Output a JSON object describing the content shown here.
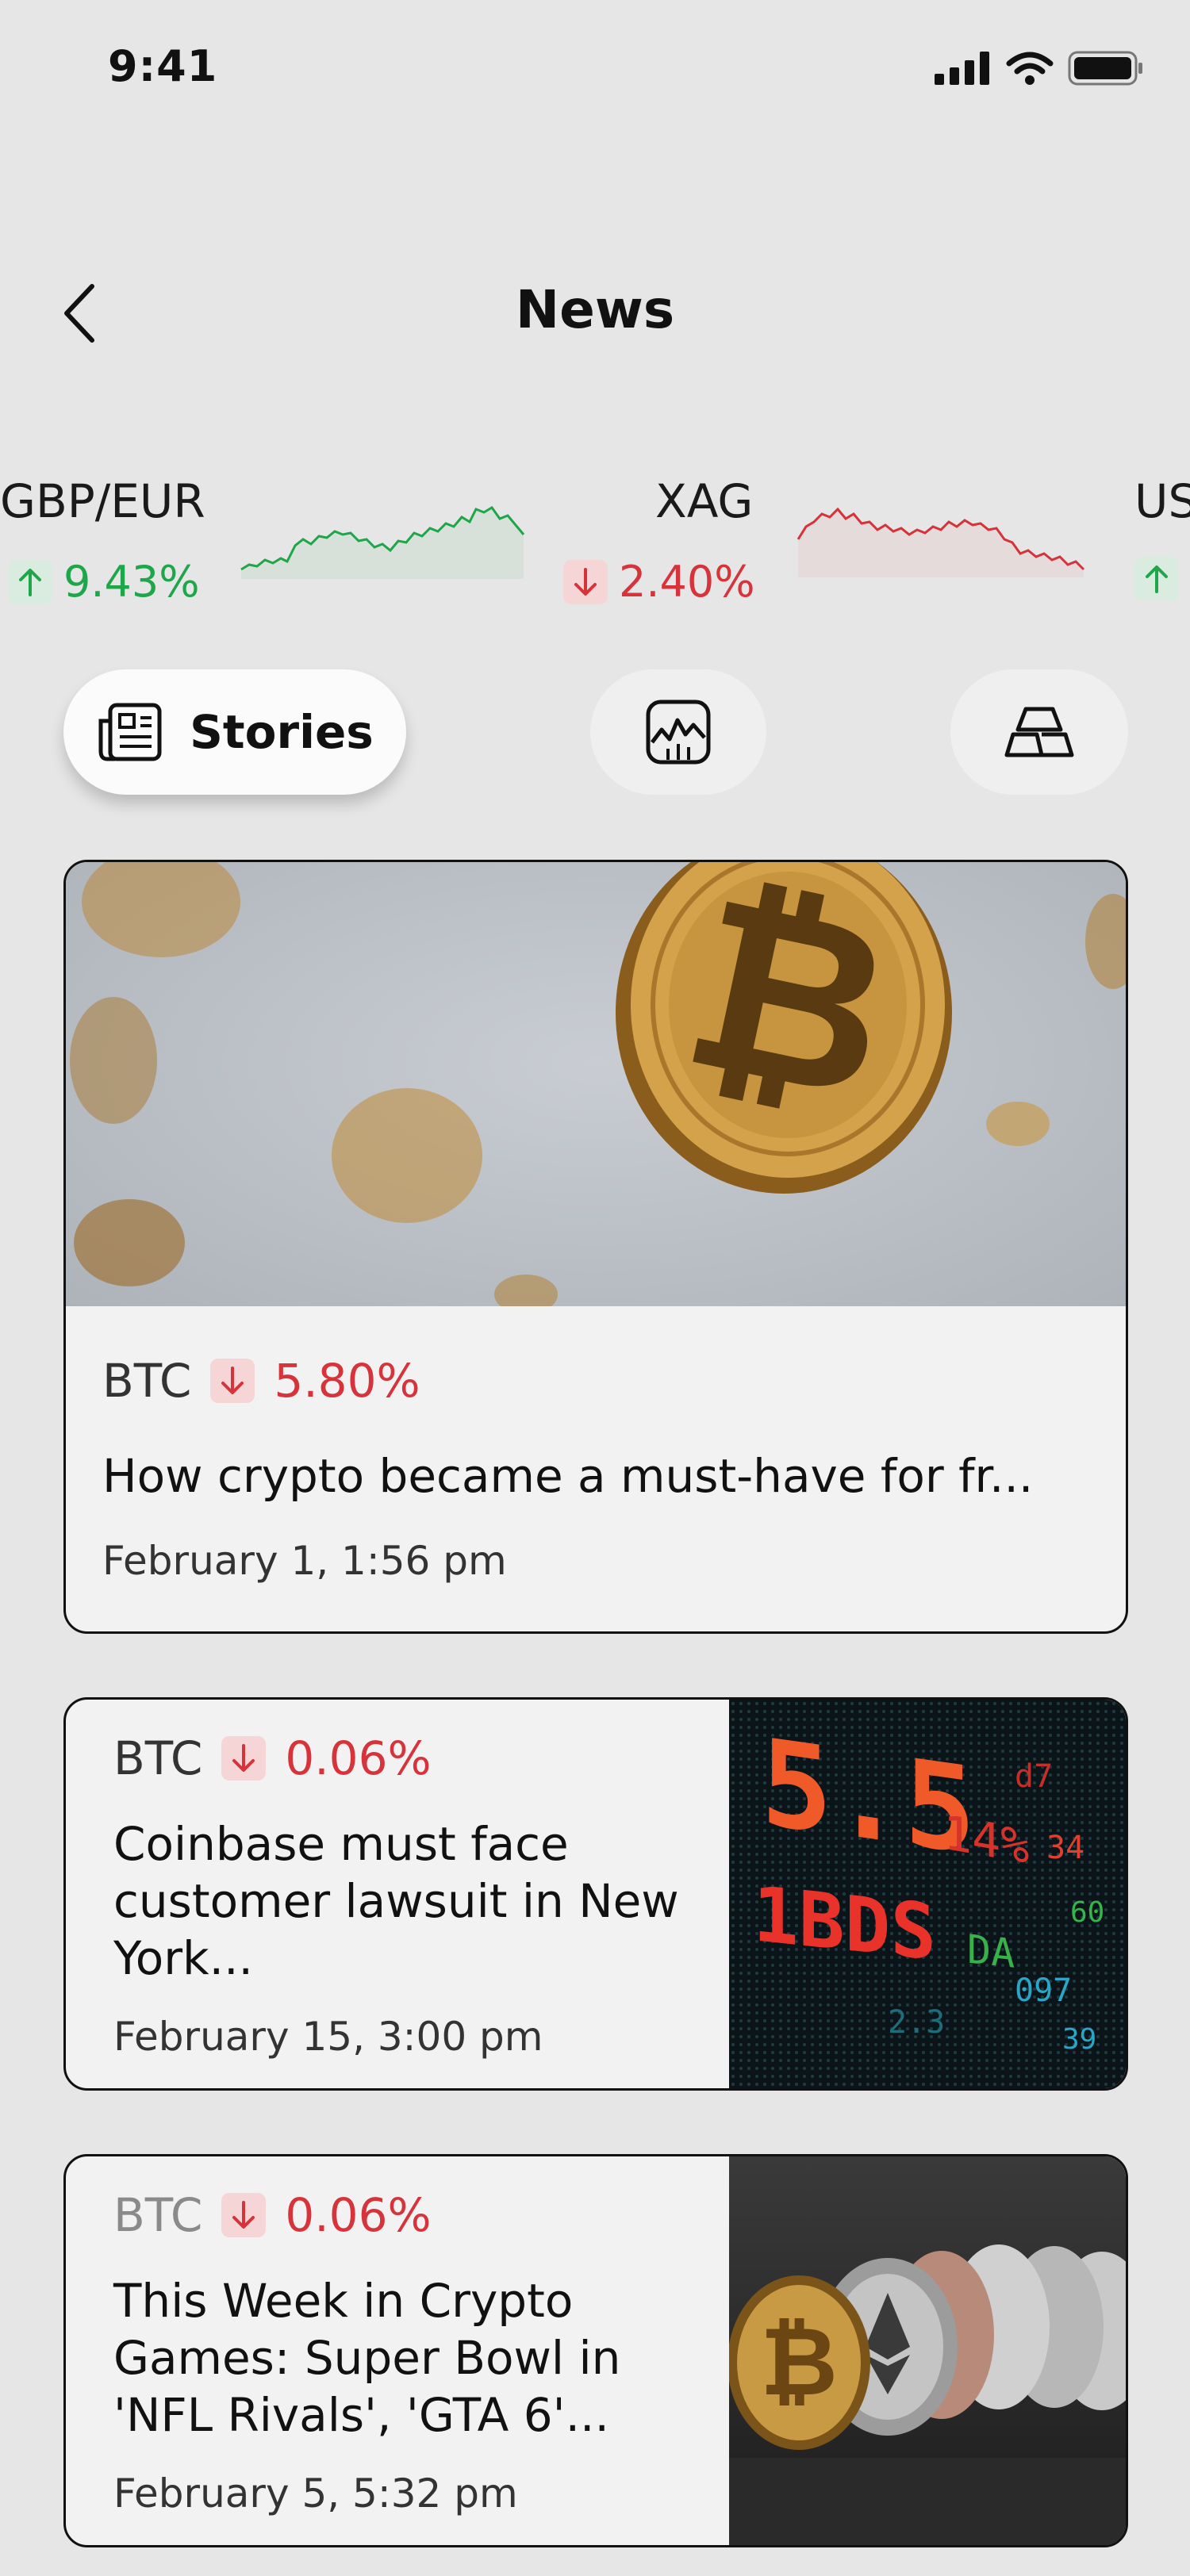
{
  "status_bar": {
    "time": "9:41"
  },
  "header": {
    "title": "News"
  },
  "tickers": [
    {
      "symbol": "GBP/EUR",
      "change": "9.43%",
      "direction": "up"
    },
    {
      "symbol": "XAG",
      "change": "2.40%",
      "direction": "down"
    },
    {
      "symbol": "US",
      "change": "",
      "direction": "up"
    }
  ],
  "filters": {
    "stories_label": "Stories",
    "stories_icon": "newspaper-icon",
    "chart_icon": "chart-icon",
    "commodities_icon": "gold-bars-icon"
  },
  "cards": [
    {
      "symbol": "BTC",
      "change": "5.80%",
      "headline": "How crypto became a must-have for fr...",
      "date": "February 1,  1:56 pm",
      "image": "bitcoin-coin-photo"
    },
    {
      "symbol": "BTC",
      "change": "0.06%",
      "headline": "Coinbase must face customer lawsuit in New York...",
      "date": "February 15,  3:00 pm",
      "image": "stock-ticker-board-photo"
    },
    {
      "symbol": "BTC",
      "change": "0.06%",
      "headline": "This Week in Crypto Games: Super Bowl in 'NFL Rivals', 'GTA 6'...",
      "date": "February 5,  5:32 pm",
      "image": "crypto-coins-row-photo"
    }
  ],
  "colors": {
    "up": "#1fa64a",
    "down": "#d6333a",
    "background": "#e6e6e6"
  }
}
